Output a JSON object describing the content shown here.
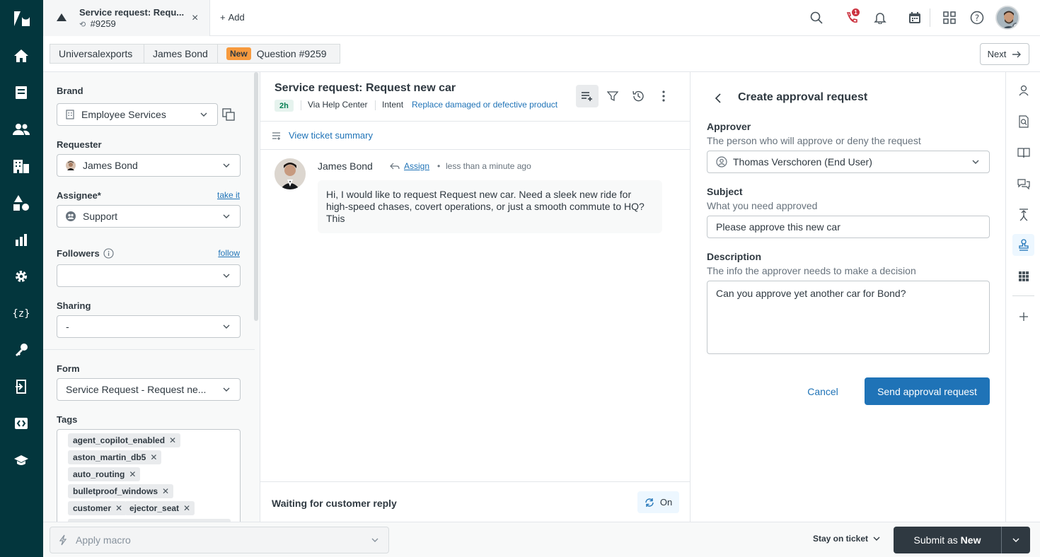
{
  "tab": {
    "title": "Service request: Requ...",
    "ticket_ref": "#9259",
    "close": "×",
    "add_label": "Add"
  },
  "breadcrumb": {
    "org": "Universalexports",
    "requester": "James Bond",
    "status_badge": "New",
    "ticket": "Question #9259",
    "next_label": "Next"
  },
  "properties": {
    "brand_label": "Brand",
    "brand_value": "Employee Services",
    "requester_label": "Requester",
    "requester_value": "James Bond",
    "assignee_label": "Assignee*",
    "assignee_link": "take it",
    "assignee_value": "Support",
    "followers_label": "Followers",
    "followers_link": "follow",
    "followers_value": "",
    "sharing_label": "Sharing",
    "sharing_value": "-",
    "form_label": "Form",
    "form_value": "Service Request - Request ne...",
    "tags_label": "Tags",
    "tags": [
      "agent_copilot_enabled",
      "aston_martin_db5",
      "auto_routing",
      "bulletproof_windows",
      "customer",
      "ejector_seat"
    ]
  },
  "conversation": {
    "title": "Service request: Request new car",
    "age": "2h",
    "channel": "Via Help Center",
    "intent_label": "Intent",
    "intent_value": "Replace damaged or defective product",
    "summary_link": "View ticket summary",
    "message": {
      "author": "James Bond",
      "assign": "Assign",
      "separator": "•",
      "time": "less than a minute ago",
      "body": "Hi, I would like to request Request new car. Need a sleek new ride for high-speed chases, covert operations, or just a smooth commute to HQ? This"
    },
    "waiting_label": "Waiting for customer reply",
    "waiting_toggle": "On"
  },
  "approval": {
    "title": "Create approval request",
    "approver_label": "Approver",
    "approver_hint": "The person who will approve or deny the request",
    "approver_value": "Thomas Verschoren (End User)",
    "subject_label": "Subject",
    "subject_hint": "What you need approved",
    "subject_value": "Please approve this new car",
    "description_label": "Description",
    "description_hint": "The info the approver needs to make a decision",
    "description_value": "Can you approve yet another car for Bond?",
    "cancel_label": "Cancel",
    "send_label": "Send approval request"
  },
  "footer": {
    "macro_label": "Apply macro",
    "stay_label": "Stay on ticket",
    "submit_prefix": "Submit as",
    "submit_status": "New"
  },
  "notifications": {
    "phone_badge": "1"
  },
  "colors": {
    "nav_bg": "#03363d",
    "accent": "#1f73b7",
    "new_badge": "#f79a3e",
    "submit_bg": "#2f3941",
    "alert": "#cc3340"
  },
  "icons": {
    "leftnav": [
      "zendesk-logo-icon",
      "home-icon",
      "views-icon",
      "customers-icon",
      "organizations-icon",
      "objects-icon",
      "reporting-icon",
      "admin-gear-icon",
      "zendesk-code-icon",
      "key-icon",
      "export-icon",
      "embed-icon",
      "learning-cap-icon"
    ],
    "topbar": [
      "search-icon",
      "phone-icon",
      "bell-icon",
      "calendar-icon",
      "apps-grid-icon",
      "help-icon",
      "user-avatar"
    ],
    "rail": [
      "user-icon",
      "knowledge-search-icon",
      "book-icon",
      "chat-bubbles-icon",
      "merge-icon",
      "approval-stamp-icon",
      "apps-icon",
      "plus-icon"
    ]
  }
}
